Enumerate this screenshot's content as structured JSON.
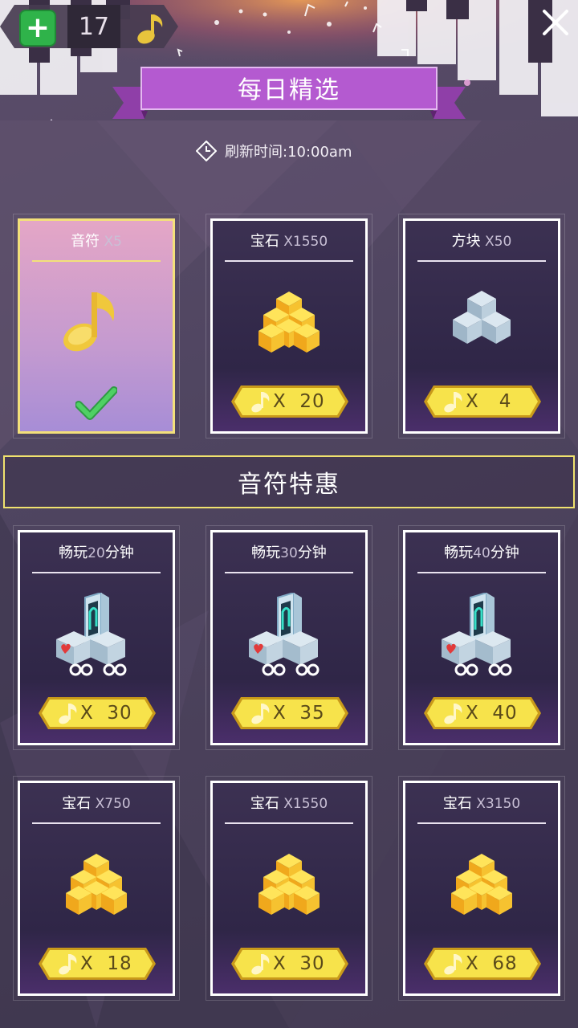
{
  "header": {
    "count": "17",
    "title": "每日精选",
    "refresh_label": "刷新时间:10:00am"
  },
  "daily": [
    {
      "name": "音符",
      "qty": "X5",
      "price": "",
      "icon": "note-icon",
      "selected": true
    },
    {
      "name": "宝石",
      "qty": "X1550",
      "price": "X  20",
      "icon": "gem-icon",
      "selected": false
    },
    {
      "name": "方块",
      "qty": "X50",
      "price": "X   4",
      "icon": "cube-icon",
      "selected": false
    }
  ],
  "section_title": "音符特惠",
  "offers": [
    {
      "name": "畅玩",
      "qty": "20",
      "unit": "分钟",
      "price": "X  30",
      "icon": "robot-icon"
    },
    {
      "name": "畅玩",
      "qty": "30",
      "unit": "分钟",
      "price": "X  35",
      "icon": "robot-icon"
    },
    {
      "name": "畅玩",
      "qty": "40",
      "unit": "分钟",
      "price": "X  40",
      "icon": "robot-icon"
    },
    {
      "name": "宝石",
      "qty": "X750",
      "unit": "",
      "price": "X  18",
      "icon": "gem-icon"
    },
    {
      "name": "宝石",
      "qty": "X1550",
      "unit": "",
      "price": "X  30",
      "icon": "gem-icon"
    },
    {
      "name": "宝石",
      "qty": "X3150",
      "unit": "",
      "price": "X  68",
      "icon": "gem-icon"
    }
  ],
  "colors": {
    "accent_gold": "#f7e34b",
    "banner_purple": "#b45ad0",
    "check_green": "#3fbf54"
  }
}
